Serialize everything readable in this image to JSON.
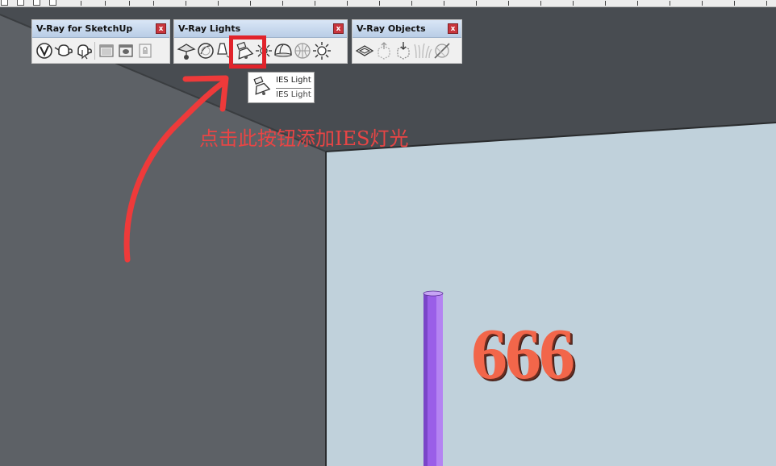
{
  "toolbars": {
    "vray_sketchup": {
      "title": "V-Ray for SketchUp",
      "close_label": "x",
      "icons": [
        "vray-logo-icon",
        "teapot-render-icon",
        "teapot-interactive-render-icon",
        "frame-buffer-icon",
        "frame-buffer-alt-icon",
        "lock-icon"
      ]
    },
    "vray_lights": {
      "title": "V-Ray Lights",
      "close_label": "x",
      "icons": [
        "rect-light-icon",
        "sphere-light-icon",
        "spot-light-icon",
        "ies-light-icon",
        "omni-light-icon",
        "dome-light-icon",
        "mesh-light-icon",
        "sun-light-icon"
      ],
      "highlighted_icon": "ies-light-icon"
    },
    "vray_objects": {
      "title": "V-Ray Objects",
      "close_label": "x",
      "icons": [
        "infinite-plane-icon",
        "proxy-export-icon",
        "proxy-import-icon",
        "fur-icon",
        "mesh-clipper-icon"
      ]
    }
  },
  "tooltip": {
    "title": "IES Light",
    "subtitle": "IES Light"
  },
  "annotation": {
    "text": "点击此按钮添加IES灯光",
    "color": "#e84545"
  },
  "scene": {
    "wall_text": "666",
    "wall_text_color": "#f2664a",
    "cylinder_color": "#9a5ee8",
    "wall_color": "#c0d1db",
    "ceiling_color": "#484c51"
  }
}
